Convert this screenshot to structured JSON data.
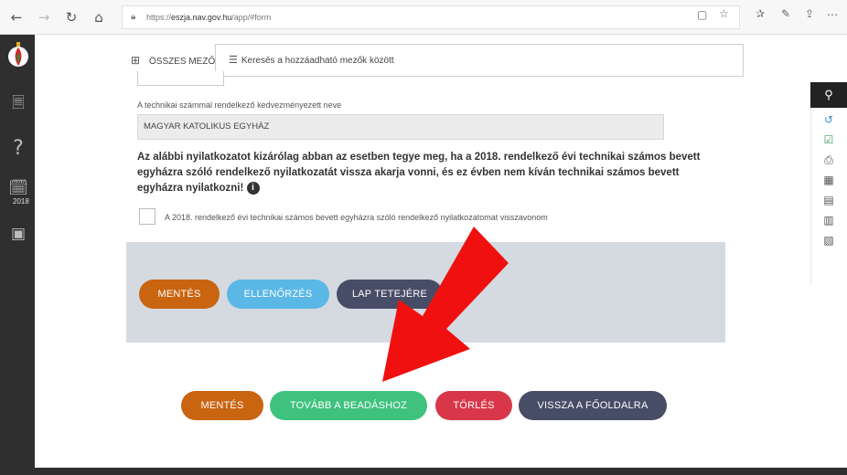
{
  "browser": {
    "url_prefix": "https://",
    "url_domain": "eszja.nav.gov.hu",
    "url_path": "/app/#form"
  },
  "sidebar": {
    "year_badge": "2018"
  },
  "toolbar": {
    "all_fields_label": "ÖSSZES MEZŐ",
    "search_placeholder": "Keresés a hozzáadható mezők között"
  },
  "form": {
    "beneficiary_label": "A technikai számmal rendelkező kedvezményezett neve",
    "beneficiary_value": "MAGYAR KATOLIKUS EGYHÁZ",
    "notice_text": "Az alábbi nyilatkozatot kizárólag abban az esetben tegye meg, ha a 2018. rendelkező évi technikai számos bevett egyházra szóló rendelkező nyilatkozatát vissza akarja vonni, és ez évben nem kíván technikai számos bevett egyházra nyilatkozni!",
    "info_icon_text": "i",
    "checkbox_label": "A 2018. rendelkező évi technikai számos bevett egyházra szóló rendelkező nyilatkozatomat visszavonom",
    "checkbox_checked": false
  },
  "panel_buttons": {
    "save": "MENTÉS",
    "check": "ELLENŐRZÉS",
    "top": "LAP TETEJÉRE"
  },
  "bottom_buttons": {
    "save": "MENTÉS",
    "submit": "TOVÁBB A BEADÁSHOZ",
    "delete": "TÖRLÉS",
    "home": "VISSZA A FŐOLDALRA"
  },
  "colors": {
    "orange": "#c96410",
    "blue": "#5bb7e6",
    "dark": "#474d66",
    "green": "#3fc27e",
    "red": "#d8374a",
    "arrow": "#f01010"
  }
}
